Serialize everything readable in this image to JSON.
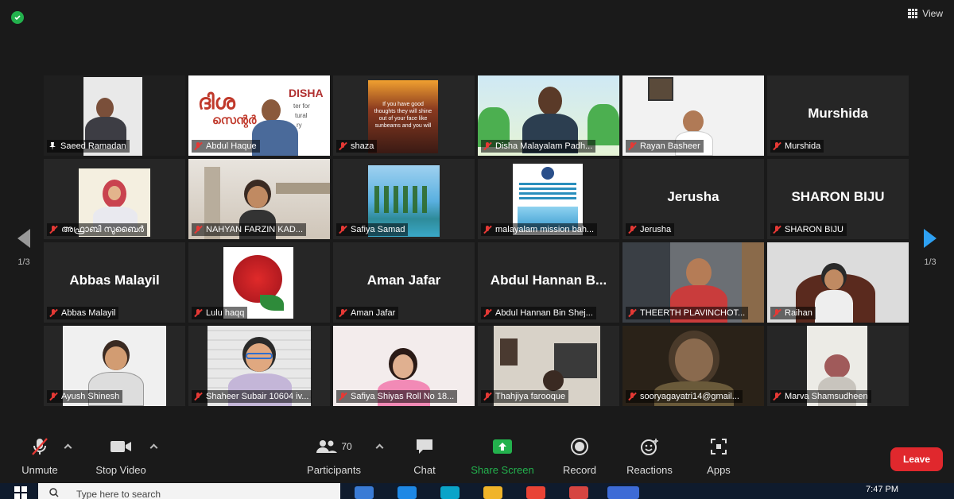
{
  "topbar": {
    "view_label": "View"
  },
  "navigation": {
    "page_left": "1/3",
    "page_right": "1/3"
  },
  "participants": [
    {
      "name": "Saeed Ramadan",
      "big": "",
      "muted": false,
      "active": true,
      "pic": "man-office"
    },
    {
      "name": "Abdul Haque",
      "big": "",
      "muted": true,
      "pic": "disha-banner",
      "banner_title": "DISHA",
      "banner_line1": "ter for",
      "banner_line2": "tural",
      "banner_line3": "ry",
      "banner_ml": "ദിശ",
      "banner_ml2": "സെന്റർ"
    },
    {
      "name": "shaza",
      "big": "",
      "muted": true,
      "pic": "sunset-quote",
      "quote": "If you have good thoughts they will shine out of your face like sunbeams and you will"
    },
    {
      "name": "Disha Malayalam Padh...",
      "big": "",
      "muted": true,
      "pic": "man-classroom"
    },
    {
      "name": "Rayan Basheer",
      "big": "",
      "muted": true,
      "pic": "boy-room"
    },
    {
      "name": "Murshida",
      "big": "Murshida",
      "muted": true,
      "pic": ""
    },
    {
      "name": "അഫ്രാബി സുബൈർ",
      "big": "",
      "muted": true,
      "pic": "girl-hijab"
    },
    {
      "name": "NAHYAN FARZIN KAD...",
      "big": "",
      "muted": true,
      "pic": "boy-building"
    },
    {
      "name": "Safiya Samad",
      "big": "",
      "muted": true,
      "pic": "palms"
    },
    {
      "name": "malayalam mission bah...",
      "big": "",
      "muted": true,
      "pic": "mission-logo"
    },
    {
      "name": "Jerusha",
      "big": "Jerusha",
      "muted": true,
      "pic": ""
    },
    {
      "name": "SHARON  BIJU",
      "big": "SHARON  BIJU",
      "muted": true,
      "pic": ""
    },
    {
      "name": "Abbas Malayil",
      "big": "Abbas Malayil",
      "muted": true,
      "pic": ""
    },
    {
      "name": "Lulu haqq",
      "big": "",
      "muted": true,
      "pic": "rose"
    },
    {
      "name": "Aman Jafar",
      "big": "Aman Jafar",
      "muted": true,
      "pic": ""
    },
    {
      "name": "Abdul Hannan Bin Shej...",
      "big": "Abdul Hannan  B...",
      "muted": true,
      "pic": ""
    },
    {
      "name": "THEERTH PLAVINCHOT...",
      "big": "",
      "muted": true,
      "pic": "boy-messy"
    },
    {
      "name": "Raihan",
      "big": "",
      "muted": true,
      "pic": "boy-chair"
    },
    {
      "name": "Ayush Shinesh",
      "big": "",
      "muted": true,
      "pic": "boy-white"
    },
    {
      "name": "Shaheer Subair 10604 iv...",
      "big": "",
      "muted": true,
      "pic": "boy-glasses"
    },
    {
      "name": "Safiya Shiyas Roll No 18...",
      "big": "",
      "muted": true,
      "pic": "girl-pink"
    },
    {
      "name": "Thahjiya  farooque",
      "big": "",
      "muted": true,
      "pic": "room-dim"
    },
    {
      "name": "sooryagayatri14@gmail...",
      "big": "",
      "muted": true,
      "pic": "girl-dark"
    },
    {
      "name": "Marva Shamsudheen",
      "big": "",
      "muted": true,
      "pic": "kid-white"
    }
  ],
  "toolbar": {
    "unmute": "Unmute",
    "stop_video": "Stop Video",
    "participants_count": "70",
    "participants": "Participants",
    "chat": "Chat",
    "share_screen": "Share Screen",
    "record": "Record",
    "reactions": "Reactions",
    "apps": "Apps",
    "leave": "Leave"
  },
  "taskbar": {
    "search_placeholder": "Type here to search",
    "time": "7:47 PM"
  },
  "colors": {
    "accent_green": "#23b14d",
    "share_green": "#23b14d",
    "leave_red": "#e0282d",
    "active_border": "#c7d246",
    "arrow_blue": "#2ea0f2"
  }
}
